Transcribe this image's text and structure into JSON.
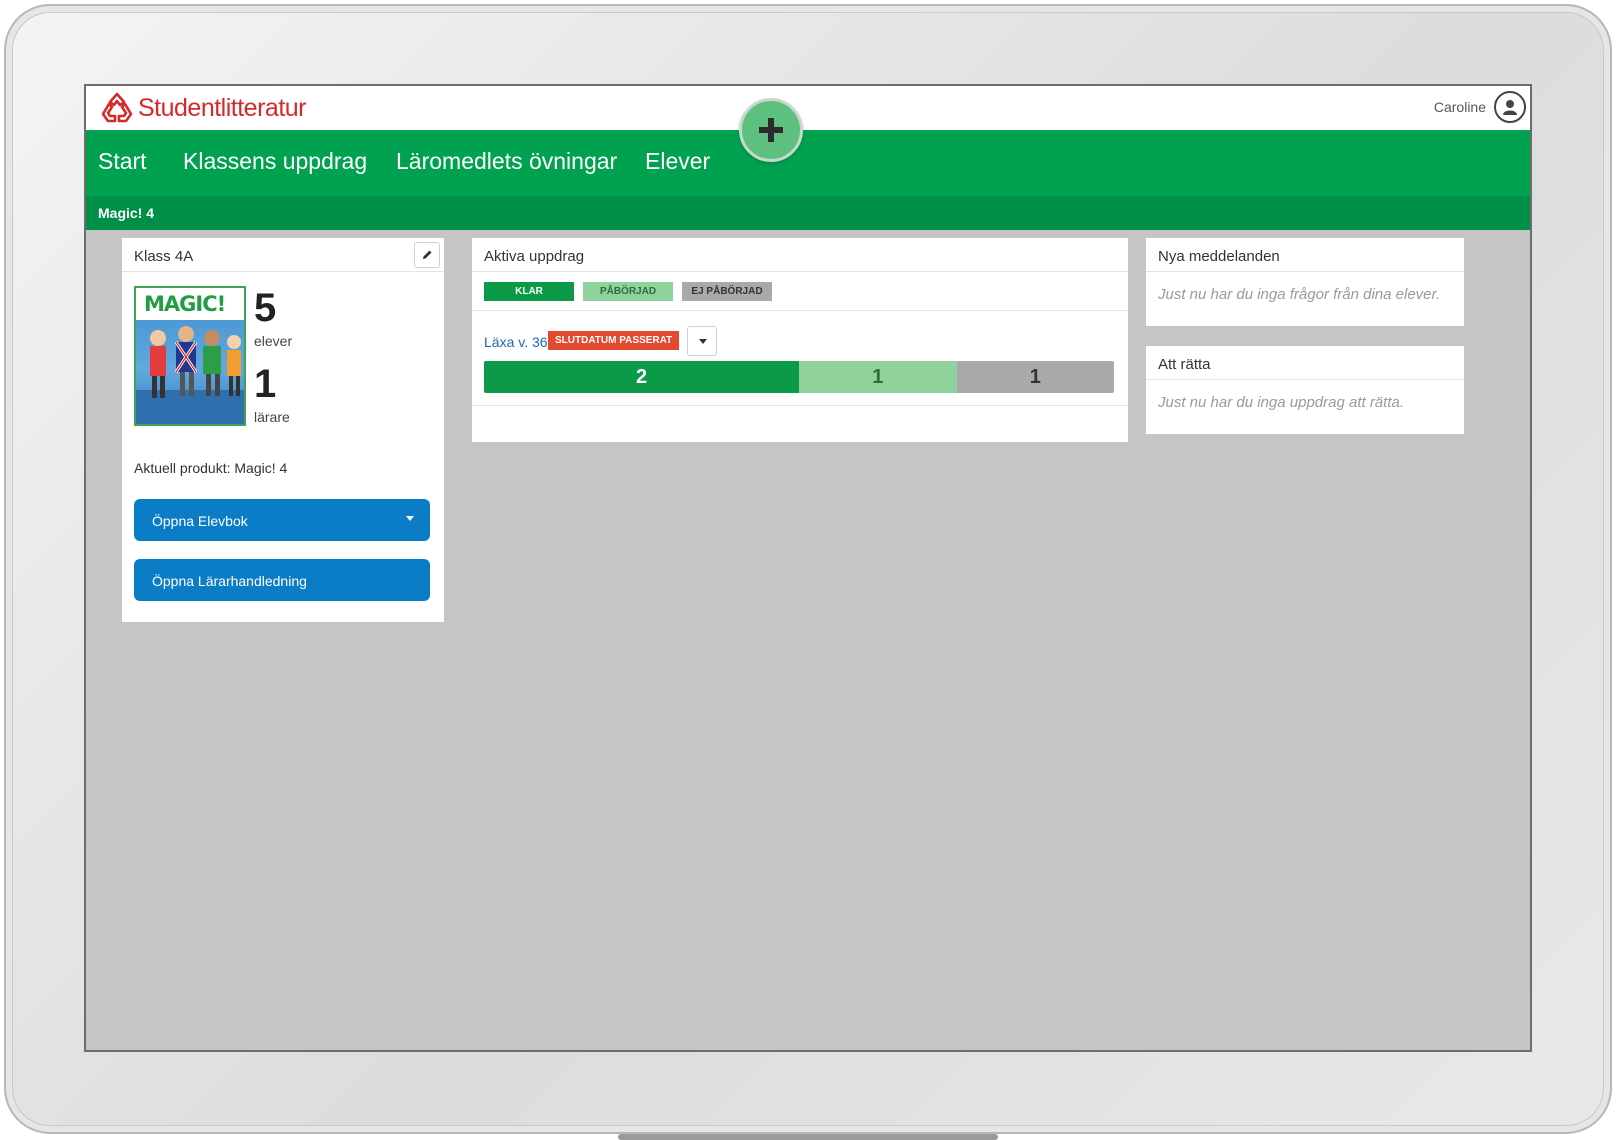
{
  "header": {
    "brand": "Studentlitteratur",
    "user_name": "Caroline",
    "brand_color": "#d62a29"
  },
  "nav": {
    "items": [
      {
        "label": "Start"
      },
      {
        "label": "Klassens uppdrag"
      },
      {
        "label": "Läromedlets övningar"
      },
      {
        "label": "Elever"
      }
    ],
    "color": "#00a24f"
  },
  "subnav": {
    "label": "Magic! 4",
    "color": "#008f47"
  },
  "add_button": {
    "icon": "plus-icon"
  },
  "class_card": {
    "title": "Klass 4A",
    "cover_title": "MAGIC!",
    "students_count": "5",
    "students_label": "elever",
    "teachers_count": "1",
    "teachers_label": "lärare",
    "product_line": "Aktuell produkt: Magic! 4",
    "open_student_book": "Öppna Elevbok",
    "open_teacher_guide": "Öppna Lärarhandledning"
  },
  "active_tasks": {
    "title": "Aktiva uppdrag",
    "legend": [
      {
        "label": "KLAR",
        "bg": "#0a9a48",
        "fg": "#ffffff"
      },
      {
        "label": "PÅBÖRJAD",
        "bg": "#8fd29b",
        "fg": "#2e6d3c"
      },
      {
        "label": "EJ PÅBÖRJAD",
        "bg": "#a9a9a9",
        "fg": "#333333"
      }
    ],
    "task": {
      "name": "Läxa v. 36",
      "badge": "SLUTDATUM PASSERAT",
      "progress": [
        {
          "label": "2",
          "value": 2,
          "bg": "#0a9a48",
          "fg": "#ffffff"
        },
        {
          "label": "1",
          "value": 1,
          "bg": "#8fd29b",
          "fg": "#2e6d3c"
        },
        {
          "label": "1",
          "value": 1,
          "bg": "#a9a9a9",
          "fg": "#333333"
        }
      ]
    }
  },
  "messages": {
    "title": "Nya meddelanden",
    "empty": "Just nu har du inga frågor från dina elever."
  },
  "to_grade": {
    "title": "Att rätta",
    "empty": "Just nu har du inga uppdrag att rätta."
  }
}
